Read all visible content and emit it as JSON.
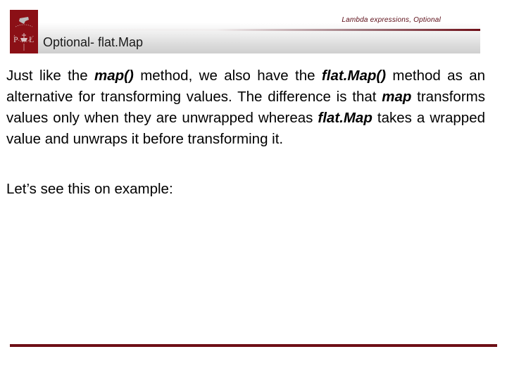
{
  "header": {
    "subtitle": "Lambda expressions, Optional",
    "title": "Optional- flat.Map",
    "logo_letters": [
      "P",
      "Ł"
    ]
  },
  "content": {
    "paragraph1": [
      {
        "text": "Just like the ",
        "emph": false
      },
      {
        "text": "map()",
        "emph": true
      },
      {
        "text": " method, we also have the ",
        "emph": false
      },
      {
        "text": "flat.Map()",
        "emph": true
      },
      {
        "text": " method as an alternative for transforming values. The difference is that ",
        "emph": false
      },
      {
        "text": "map",
        "emph": true
      },
      {
        "text": " transforms values only when they are unwrapped whereas ",
        "emph": false
      },
      {
        "text": "flat.Map",
        "emph": true
      },
      {
        "text": " takes a wrapped value and unwraps it before transforming it.",
        "emph": false
      }
    ],
    "paragraph2": "Let’s see this on example:"
  },
  "colors": {
    "brand": "#8b1016",
    "footer_line": "#6e0f16",
    "subtitle": "#5a0a14"
  }
}
